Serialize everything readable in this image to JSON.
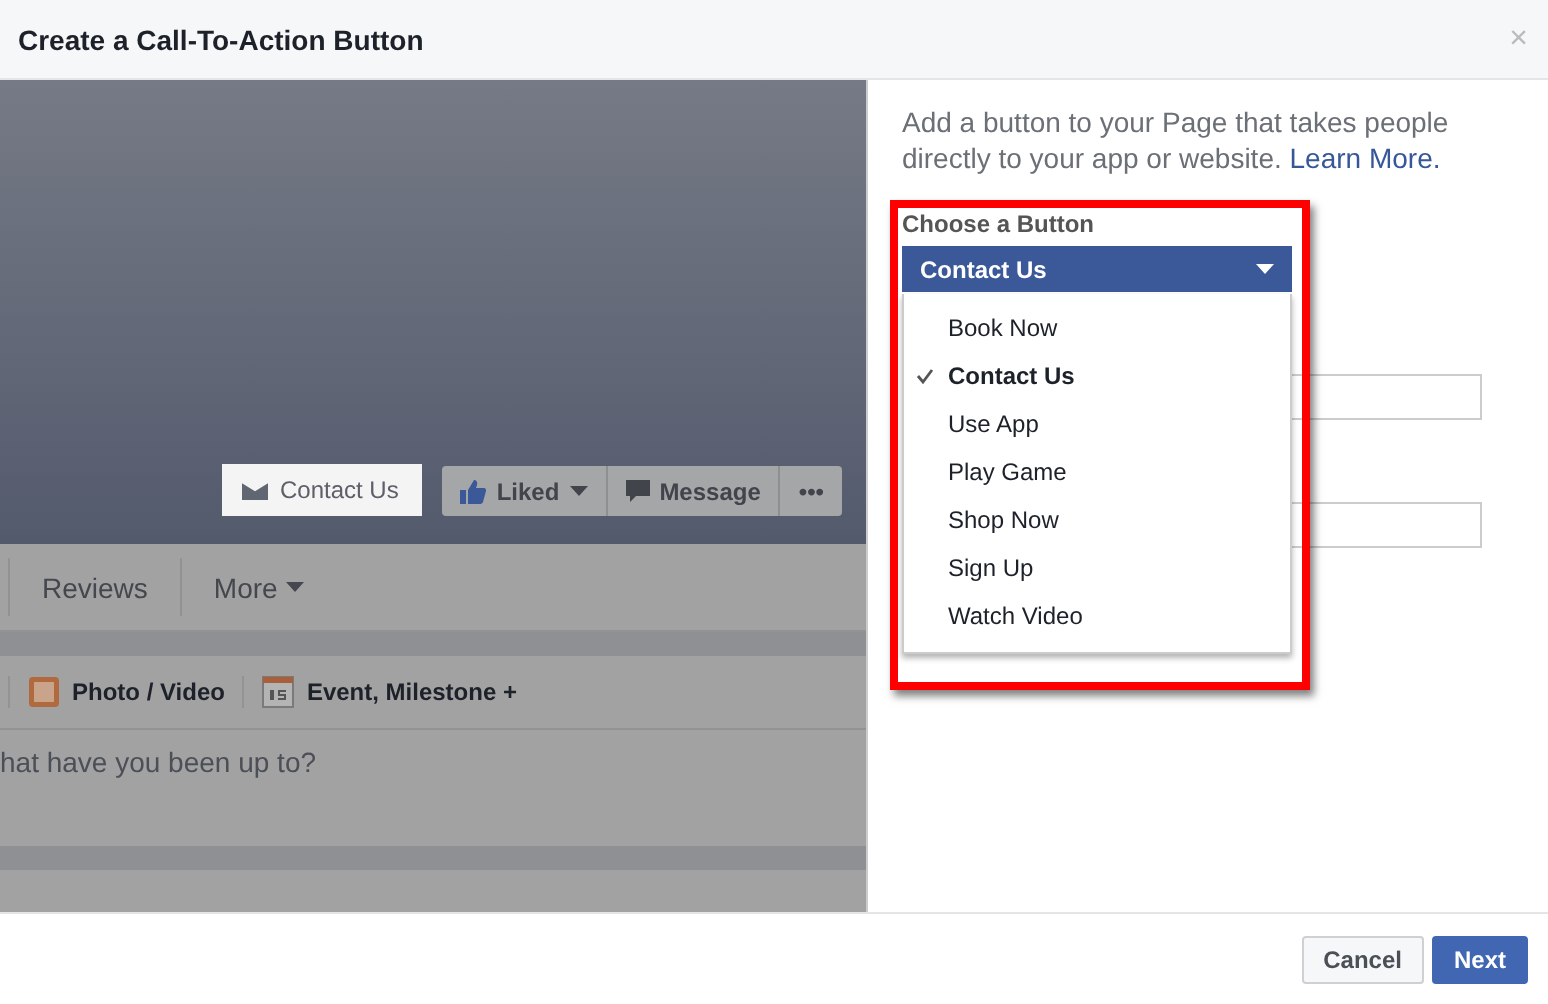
{
  "dialog": {
    "title": "Create a Call-To-Action Button",
    "close": "×"
  },
  "preview": {
    "cover_buttons": [
      {
        "kind": "cta",
        "label": "Contact Us"
      },
      {
        "kind": "liked",
        "label": "Liked"
      },
      {
        "kind": "message",
        "label": "Message"
      },
      {
        "kind": "more",
        "label": "•••"
      }
    ],
    "tabs": [
      {
        "label": "Reviews",
        "dropdown": false
      },
      {
        "label": "More",
        "dropdown": true
      }
    ],
    "composer_actions": [
      {
        "kind": "photo",
        "label": "Photo / Video"
      },
      {
        "kind": "event",
        "label": "Event, Milestone +"
      }
    ],
    "composer_placeholder": "hat have you been up to?"
  },
  "panel": {
    "description": "Add a button to your Page that takes people directly to your app or website.",
    "link": "Learn More.",
    "field_label": "Choose a Button",
    "select_value": "Contact Us",
    "options": [
      {
        "label": "Book Now",
        "selected": false
      },
      {
        "label": "Contact Us",
        "selected": true
      },
      {
        "label": "Use App",
        "selected": false
      },
      {
        "label": "Play Game",
        "selected": false
      },
      {
        "label": "Shop Now",
        "selected": false
      },
      {
        "label": "Sign Up",
        "selected": false
      },
      {
        "label": "Watch Video",
        "selected": false
      }
    ]
  },
  "footer": {
    "buttons": [
      {
        "label": "Cancel",
        "primary": false
      },
      {
        "label": "Next",
        "primary": true
      }
    ]
  }
}
